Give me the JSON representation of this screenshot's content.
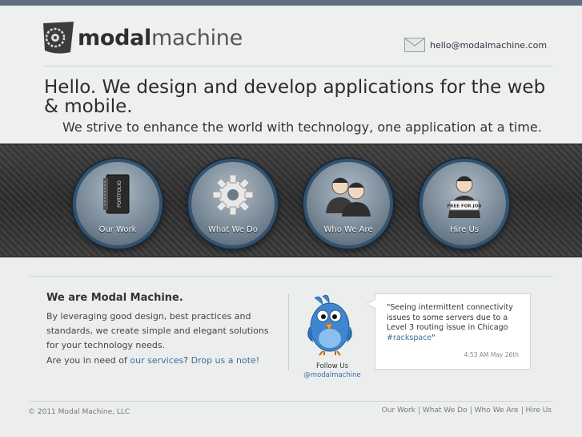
{
  "brand": {
    "name_bold": "modal",
    "name_light": "machine"
  },
  "contact": {
    "email": "hello@modalmachine.com"
  },
  "hero": {
    "title": "Hello. We design and develop applications for the web & mobile.",
    "tagline": "We strive to enhance the world with technology, one application at a time."
  },
  "features": [
    {
      "label": "Our Work",
      "icon": "portfolio-binder-icon",
      "badge": "PORTFOLIO"
    },
    {
      "label": "What We Do",
      "icon": "gear-icon"
    },
    {
      "label": "Who We Are",
      "icon": "people-icon"
    },
    {
      "label": "Hire Us",
      "icon": "person-sign-icon",
      "badge": "FREE FOR JOB"
    }
  ],
  "about": {
    "title": "We are Modal Machine.",
    "text": "By leveraging good design, best practices and standards, we create simple and elegant solutions for your technology needs.",
    "question_prefix": "Are you in need of ",
    "question_link1": "our services",
    "question_mid": "? ",
    "question_link2": "Drop us a note!"
  },
  "twitter": {
    "follow_label": "Follow Us",
    "handle": "@modalmachine",
    "tweet_text": "\"Seeing intermittent connectivity issues to some servers due to a Level 3 routing issue in Chicago ",
    "tweet_hashtag": "#rackspace",
    "tweet_close": "\"",
    "tweet_time": "4:53 AM May 26th"
  },
  "footer": {
    "copyright": "© 2011 Modal Machine, LLC",
    "nav": [
      "Our Work",
      "What We Do",
      "Who We Are",
      "Hire Us"
    ]
  },
  "colors": {
    "accent_link": "#3a6ea0",
    "top_bar": "#5f6f7b",
    "circle_ring": "#34536f"
  }
}
